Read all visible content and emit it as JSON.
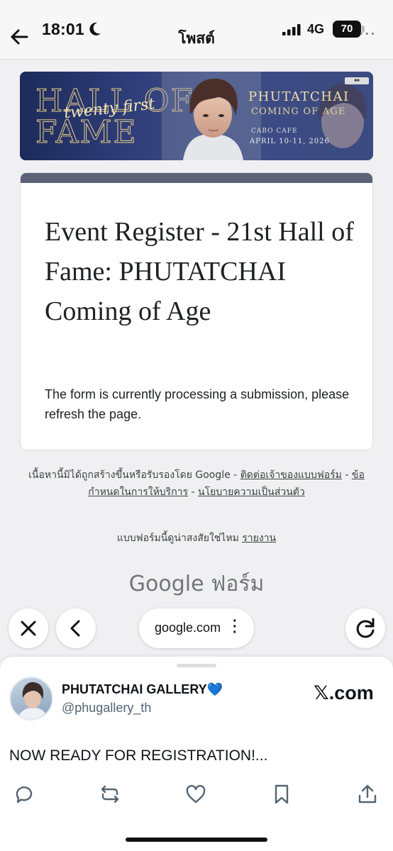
{
  "status_bar": {
    "time": "18:01",
    "network": "4G",
    "battery": "70"
  },
  "header": {
    "title": "โพสต์"
  },
  "banner": {
    "hall_text": "HALL OF FAME",
    "script_text": "twenty first",
    "name": "PHUTATCHAI",
    "subtitle": "COMING OF AGE",
    "venue": "CABO CAFE",
    "date": "APRIL 10-11, 2026"
  },
  "form": {
    "title": "Event Register - 21st Hall of Fame: PHUTATCHAI Coming of Age",
    "message": "The form is currently processing a submission, please refresh the page."
  },
  "footer": {
    "disclaimer": "เนื้อหานี้มิได้ถูกสร้างขึ้นหรือรับรองโดย Google -",
    "contact_link": "ติดต่อเจ้าของแบบฟอร์ม",
    "terms_link": "ข้อกำหนดในการให้บริการ",
    "privacy_link": "นโยบายความเป็นส่วนตัว",
    "report_question": "แบบฟอร์มนี้ดูน่าสงสัยใช่ไหม",
    "report_link": "รายงาน",
    "google_forms": "Google ฟอร์ม"
  },
  "browser": {
    "url": "google.com"
  },
  "tweet": {
    "name": "PHUTATCHAI GALLERY💙",
    "handle": "@phugallery_th",
    "source": "𝕏.com",
    "text": "NOW READY FOR REGISTRATION!..."
  },
  "colors": {
    "form_accent": "#5b6276",
    "background": "#f0f0f2"
  }
}
